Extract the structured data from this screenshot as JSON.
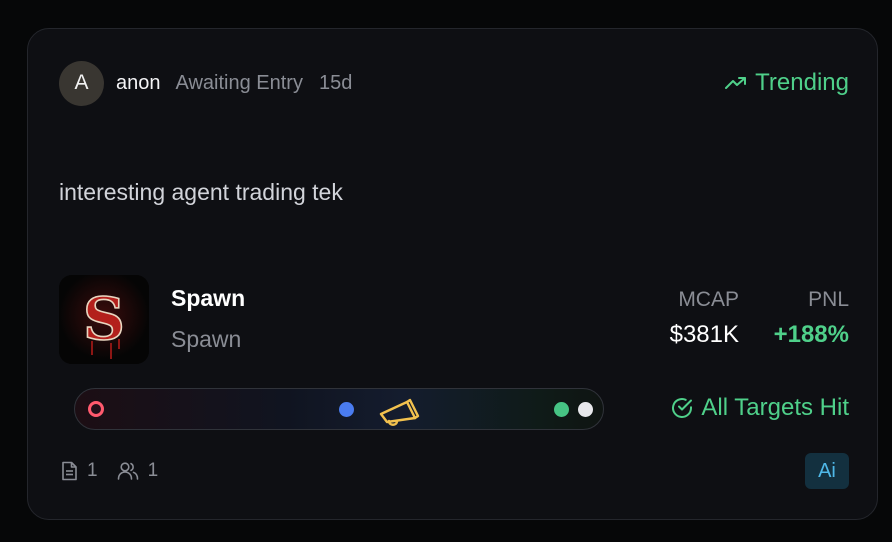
{
  "post": {
    "avatar_letter": "A",
    "author": "anon",
    "status": "Awaiting Entry",
    "age": "15d",
    "trending_label": "Trending",
    "message": "interesting agent trading tek"
  },
  "token": {
    "logo_letter": "S",
    "name": "Spawn",
    "ticker": "Spawn"
  },
  "stats": {
    "mcap_label": "MCAP",
    "mcap_value": "$381K",
    "pnl_label": "PNL",
    "pnl_value": "+188%"
  },
  "progress": {
    "icon": "megaphone-icon",
    "markers": [
      "entry-red",
      "current-blue",
      "target-green",
      "target-white"
    ]
  },
  "targets_label": "All Targets Hit",
  "footer": {
    "posts_count": "1",
    "users_count": "1",
    "badge": "Ai"
  },
  "colors": {
    "accent_green": "#4fd08a",
    "marker_red": "#ff5a6e",
    "marker_blue": "#4a7cf0",
    "marker_green": "#46c484",
    "megaphone": "#f2c14e",
    "badge_text": "#4fb8e8"
  }
}
